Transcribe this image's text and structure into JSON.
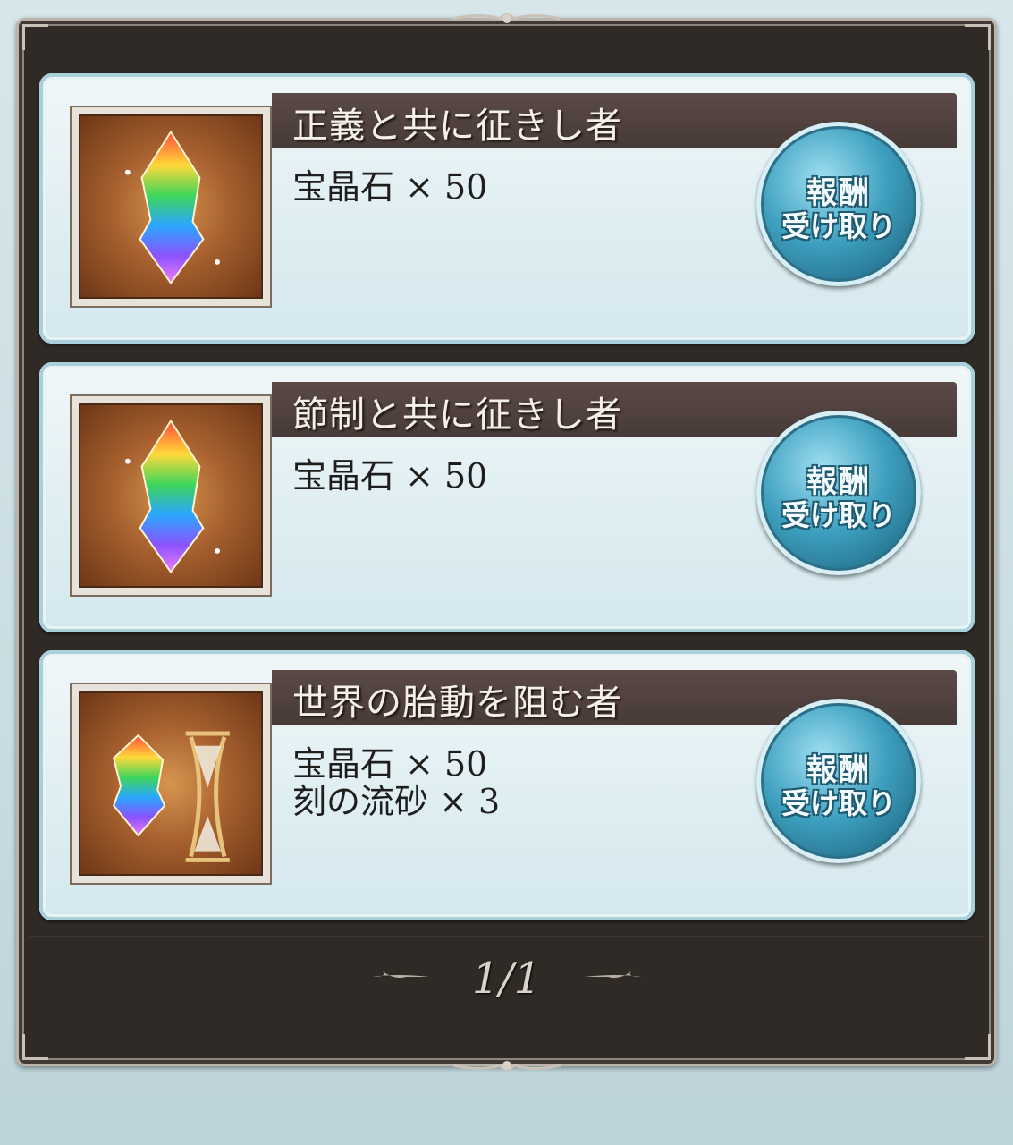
{
  "missions": [
    {
      "title": "正義と共に征きし者",
      "rewards": [
        "宝晶石 × 50"
      ],
      "icon": "rainbow-crystal",
      "claim_line1": "報酬",
      "claim_line2": "受け取り"
    },
    {
      "title": "節制と共に征きし者",
      "rewards": [
        "宝晶石 × 50"
      ],
      "icon": "rainbow-crystal",
      "claim_line1": "報酬",
      "claim_line2": "受け取り"
    },
    {
      "title": "世界の胎動を阻む者",
      "rewards": [
        "宝晶石 × 50",
        "刻の流砂 × 3"
      ],
      "icon": "crystal-and-hourglass",
      "claim_line1": "報酬",
      "claim_line2": "受け取り"
    }
  ],
  "pager": {
    "label": "1/1"
  },
  "colors": {
    "header": "#4f403d",
    "button": "#3d9fbe",
    "frame": "#2f2a26"
  }
}
